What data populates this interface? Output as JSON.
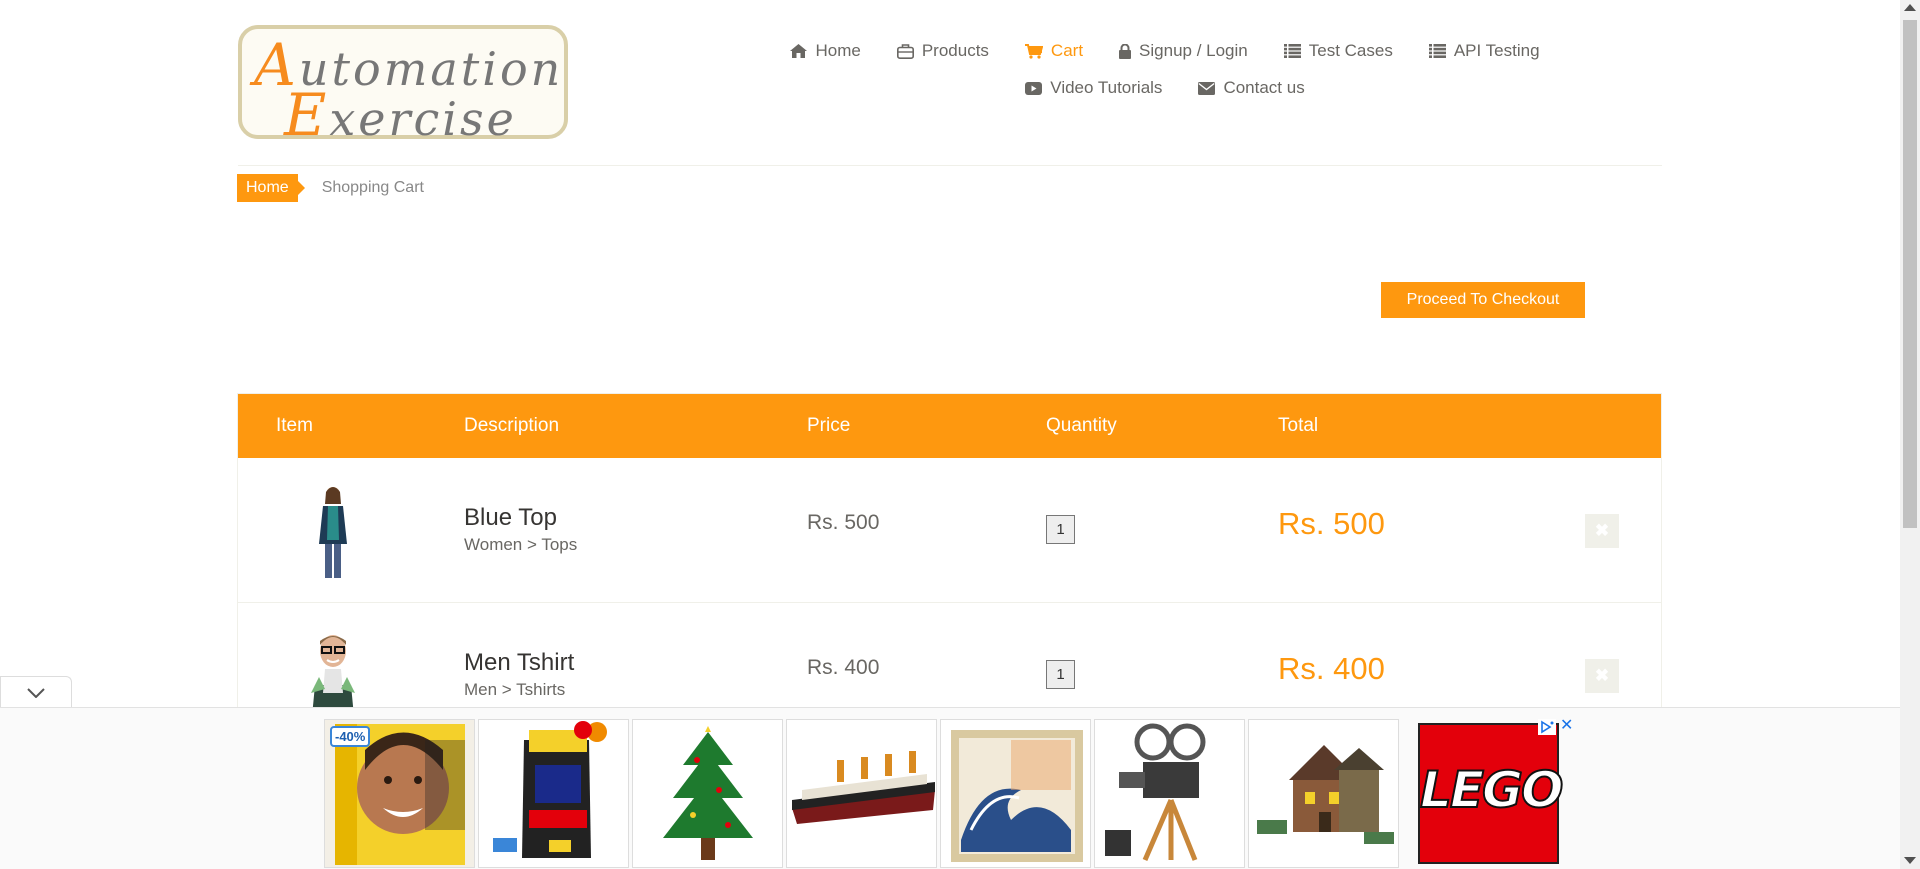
{
  "logo": {
    "line1": "utomation",
    "line1_cap": "A",
    "line2": "xercise",
    "line2_cap": "E"
  },
  "nav": {
    "items": [
      {
        "label": "Home",
        "icon": "home-icon"
      },
      {
        "label": "Products",
        "icon": "briefcase-icon"
      },
      {
        "label": "Cart",
        "icon": "shopping-cart-icon",
        "active": true
      },
      {
        "label": "Signup / Login",
        "icon": "lock-icon"
      },
      {
        "label": "Test Cases",
        "icon": "list-icon"
      },
      {
        "label": "API Testing",
        "icon": "list-icon"
      },
      {
        "label": "Video Tutorials",
        "icon": "youtube-play-icon"
      },
      {
        "label": "Contact us",
        "icon": "envelope-icon"
      }
    ]
  },
  "breadcrumb": {
    "home": "Home",
    "current": "Shopping Cart"
  },
  "checkout": {
    "label": "Proceed To Checkout"
  },
  "cart": {
    "headers": {
      "item": "Item",
      "description": "Description",
      "price": "Price",
      "quantity": "Quantity",
      "total": "Total"
    },
    "rows": [
      {
        "name": "Blue Top",
        "category": "Women > Tops",
        "price": "Rs. 500",
        "quantity": "1",
        "total": "Rs. 500",
        "delete": "✖"
      },
      {
        "name": "Men Tshirt",
        "category": "Men > Tshirts",
        "price": "Rs. 400",
        "quantity": "1",
        "total": "Rs. 400",
        "delete": "✖"
      }
    ]
  },
  "ad": {
    "discount_badge": "-40%",
    "brand": "LEGO",
    "close": "✕"
  },
  "colors": {
    "accent": "#fe980f",
    "text": "#696763",
    "lego_red": "#e3000b"
  }
}
